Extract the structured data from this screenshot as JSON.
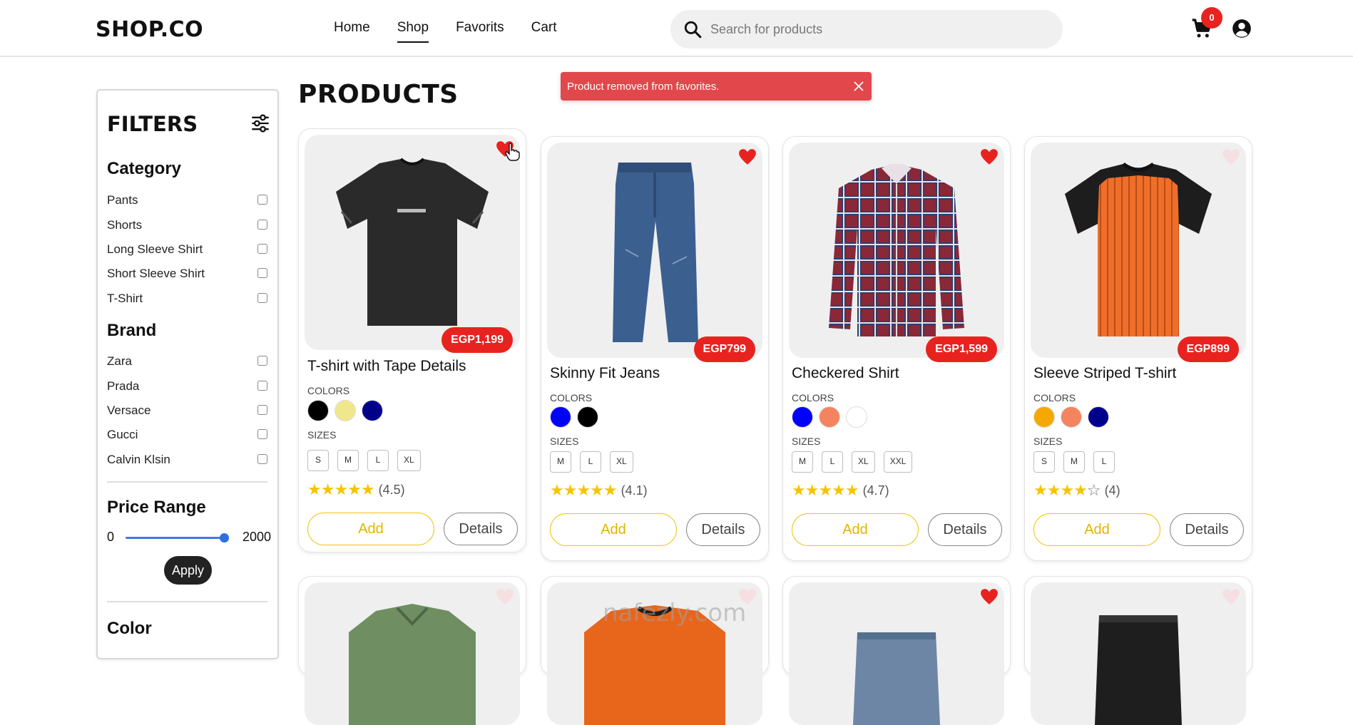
{
  "header": {
    "logo": "SHOP.CO",
    "nav": [
      "Home",
      "Shop",
      "Favorits",
      "Cart"
    ],
    "active_nav": "Shop",
    "search_placeholder": "Search for products",
    "cart_count": "0"
  },
  "toast": {
    "message": "Product removed from favorites."
  },
  "filters": {
    "title": "FILTERS",
    "category_title": "Category",
    "categories": [
      "Pants",
      "Shorts",
      "Long Sleeve Shirt",
      "Short Sleeve Shirt",
      "T-Shirt"
    ],
    "brand_title": "Brand",
    "brands": [
      "Zara",
      "Prada",
      "Versace",
      "Gucci",
      "Calvin Klsin"
    ],
    "price_title": "Price Range",
    "price_min": "0",
    "price_max": "2000",
    "price_fill_fraction": 1.0,
    "apply_label": "Apply",
    "color_title": "Color"
  },
  "page_title": "PRODUCTS",
  "products": [
    {
      "name": "T-shirt with Tape Details",
      "price": "EGP1,199",
      "favorite": true,
      "colors": [
        "#000000",
        "#f0e68c",
        "#00008b"
      ],
      "sizes": [
        "S",
        "M",
        "L",
        "XL"
      ],
      "stars": "★★★★★",
      "rating": "(4.5)"
    },
    {
      "name": "Skinny Fit Jeans",
      "price": "EGP799",
      "favorite": true,
      "colors": [
        "#0000ff",
        "#000000"
      ],
      "sizes": [
        "M",
        "L",
        "XL"
      ],
      "stars": "★★★★★",
      "rating": "(4.1)"
    },
    {
      "name": "Checkered Shirt",
      "price": "EGP1,599",
      "favorite": true,
      "colors": [
        "#0000ff",
        "#f4845f",
        "#ffffff"
      ],
      "sizes": [
        "M",
        "L",
        "XL",
        "XXL"
      ],
      "stars": "★★★★★",
      "rating": "(4.7)"
    },
    {
      "name": "Sleeve Striped T-shirt",
      "price": "EGP899",
      "favorite": false,
      "colors": [
        "#f5a800",
        "#f4845f",
        "#00008b"
      ],
      "sizes": [
        "S",
        "M",
        "L"
      ],
      "stars": "★★★★",
      "rating": "(4)"
    }
  ],
  "labels": {
    "colors": "COLORS",
    "sizes": "SIZES",
    "add": "Add",
    "details": "Details"
  },
  "watermark": "nafezly.com",
  "colors": {
    "accent_red": "#e8231f",
    "toast_red": "#e2474c",
    "add_yellow": "#f1c40f",
    "slider_blue": "#2b6fe0"
  }
}
